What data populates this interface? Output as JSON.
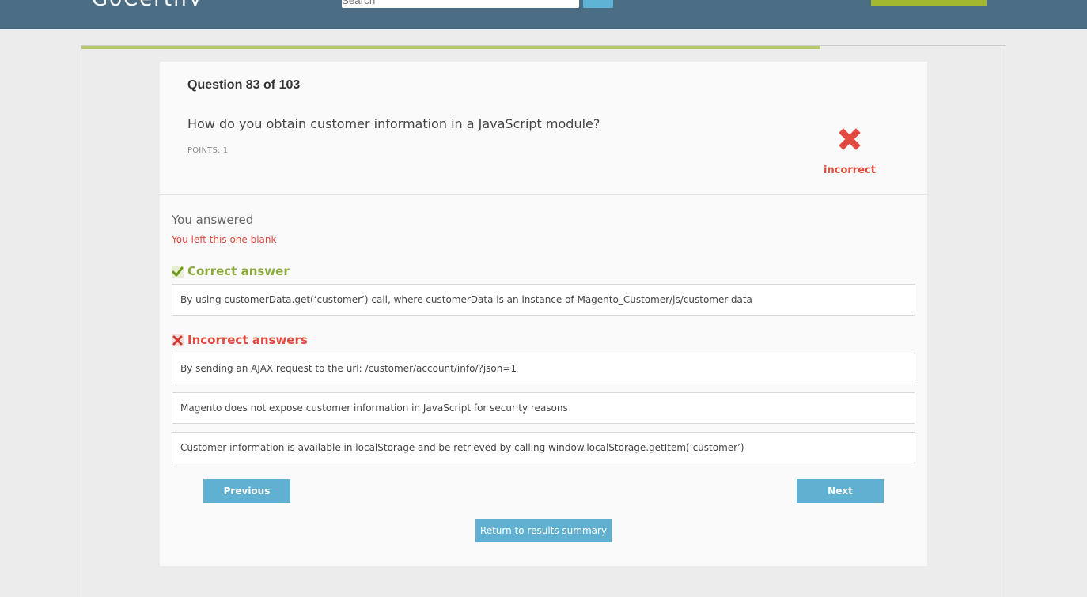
{
  "header": {
    "logo_text": "GoCertify",
    "search_placeholder": "Search",
    "search_icon": "search-icon",
    "action_label": ""
  },
  "progress": {
    "fraction": 0.8
  },
  "question": {
    "number_label": "Question 83 of 103",
    "text": "How do you obtain customer information in a JavaScript module?",
    "points_label": "POINTS: 1",
    "result_icon": "close-icon",
    "result_label": "incorrect"
  },
  "user_answer": {
    "heading": "You answered",
    "value": "You left this one blank"
  },
  "correct_section": {
    "icon": "checkmark-icon",
    "title": "Correct answer",
    "answers": [
      "By using customerData.get(‘customer’) call, where customerData is an instance of Magento_Customer/js/customer-data"
    ]
  },
  "incorrect_section": {
    "icon": "close-icon",
    "title": "Incorrect answers",
    "answers": [
      "By sending an AJAX request to the url: /customer/account/info/?json=1",
      "Magento does not expose customer information in JavaScript for security reasons",
      "Customer information is available in localStorage and be retrieved by calling window.localStorage.getItem(‘customer’)"
    ]
  },
  "navigation": {
    "previous_label": "Previous",
    "next_label": "Next",
    "summary_label": "Return to results summary"
  },
  "colors": {
    "header_bg": "#4b6e84",
    "accent_green": "#8aa93a",
    "incorrect_red": "#e04a3f",
    "button_blue": "#60b0d2"
  }
}
